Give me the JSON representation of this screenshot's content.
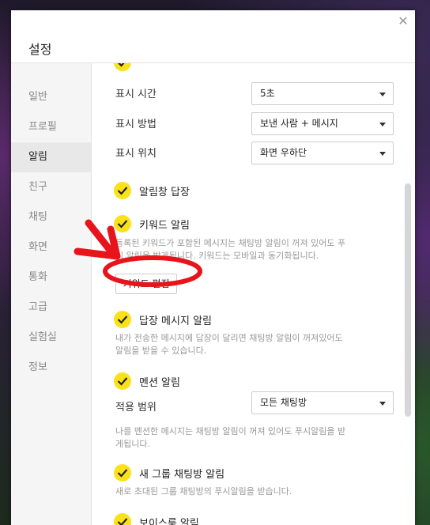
{
  "dialog": {
    "title": "설정",
    "close": "✕"
  },
  "sidebar": {
    "items": [
      {
        "label": "일반"
      },
      {
        "label": "프로필"
      },
      {
        "label": "알림"
      },
      {
        "label": "친구"
      },
      {
        "label": "채팅"
      },
      {
        "label": "화면"
      },
      {
        "label": "통화"
      },
      {
        "label": "고급"
      },
      {
        "label": "실험실"
      },
      {
        "label": "정보"
      }
    ],
    "active_index": 2
  },
  "notifications": {
    "display_time": {
      "label": "표시 시간",
      "value": "5초"
    },
    "display_method": {
      "label": "표시 방법",
      "value": "보낸 사람 + 메시지"
    },
    "display_position": {
      "label": "표시 위치",
      "value": "화면 우하단"
    },
    "reply_in_popup": {
      "label": "알림창 답장",
      "checked": true
    },
    "keyword_alert": {
      "label": "키워드 알림",
      "checked": true,
      "desc1": "등록된 키워드가 포함된 메시지는 채팅방 알림이 꺼져 있어도 푸",
      "desc2": "시 알림을 받게됩니다. 키워드는 모바일과 동기화됩니다.",
      "edit_button": "키워드 편집"
    },
    "reply_message_alert": {
      "label": "답장 메시지 알림",
      "checked": true,
      "desc1": "내가 전송한 메시지에 답장이 달리면 채팅방 알림이 꺼져있어도",
      "desc2": "알림을 받을 수 있습니다."
    },
    "mention_alert": {
      "label": "멘션 알림",
      "checked": true,
      "scope_label": "적용 범위",
      "scope_value": "모든 채팅방",
      "desc1": "나를 멘션한 메시지는 채팅방 알림이 꺼져 있어도 푸시알림을 받",
      "desc2": "게됩니다."
    },
    "new_group_alert": {
      "label": "새 그룹 채팅방 알림",
      "checked": true,
      "desc1": "새로 초대된 그룹 채팅방의 푸시알림을 받습니다."
    },
    "voice_room_alert": {
      "label": "보이스룸 알림",
      "checked": true
    }
  },
  "colors": {
    "check_accent": "#fbe11a",
    "annotation": "#e8141b"
  }
}
